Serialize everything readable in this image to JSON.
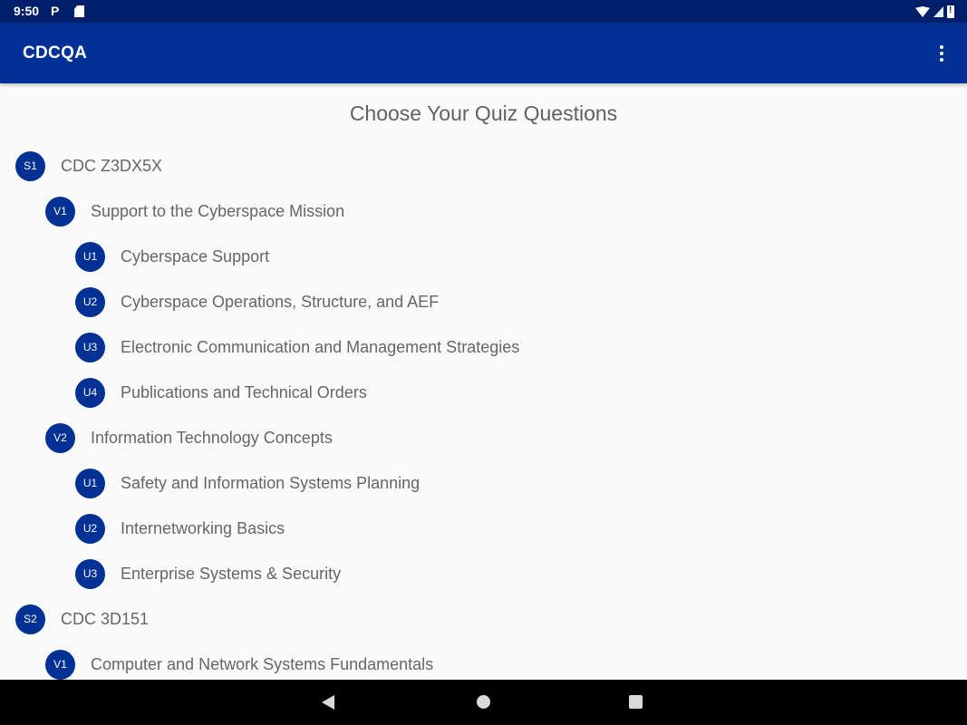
{
  "status_bar": {
    "time": "9:50",
    "notification_letter": "P",
    "left_icons": [
      "parking-icon",
      "sd-card-icon"
    ],
    "right_icons": [
      "wifi-icon",
      "cell-signal-icon",
      "battery-alert-icon"
    ]
  },
  "app_bar": {
    "title": "CDCQA",
    "overflow_icon": "more-vert-icon",
    "color": "#013195"
  },
  "heading": "Choose Your Quiz Questions",
  "tree": {
    "items": [
      {
        "level": 0,
        "badge": "S1",
        "label": "CDC Z3DX5X"
      },
      {
        "level": 1,
        "badge": "V1",
        "label": "Support to the Cyberspace Mission"
      },
      {
        "level": 2,
        "badge": "U1",
        "label": "Cyberspace Support"
      },
      {
        "level": 2,
        "badge": "U2",
        "label": "Cyberspace Operations, Structure, and AEF"
      },
      {
        "level": 2,
        "badge": "U3",
        "label": "Electronic Communication and Management Strategies"
      },
      {
        "level": 2,
        "badge": "U4",
        "label": "Publications and Technical Orders"
      },
      {
        "level": 1,
        "badge": "V2",
        "label": "Information Technology Concepts"
      },
      {
        "level": 2,
        "badge": "U1",
        "label": "Safety and Information Systems Planning"
      },
      {
        "level": 2,
        "badge": "U2",
        "label": "Internetworking Basics"
      },
      {
        "level": 2,
        "badge": "U3",
        "label": "Enterprise Systems & Security"
      },
      {
        "level": 0,
        "badge": "S2",
        "label": "CDC 3D151"
      },
      {
        "level": 1,
        "badge": "V1",
        "label": "Computer and Network Systems Fundamentals"
      }
    ]
  },
  "nav_bar": {
    "buttons": [
      "back-icon",
      "home-icon",
      "recents-icon"
    ]
  },
  "colors": {
    "status_bar": "#001f6b",
    "accent": "#013195",
    "text": "#666666",
    "background": "#fafafa"
  }
}
